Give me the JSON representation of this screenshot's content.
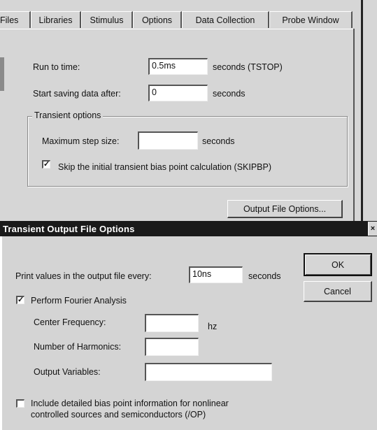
{
  "sim_settings": {
    "tabs": [
      "Files",
      "Libraries",
      "Stimulus",
      "Options",
      "Data Collection",
      "Probe Window"
    ],
    "run_to_time_label": "Run to time:",
    "run_to_time_value": "0.5ms",
    "run_to_time_units": "seconds (TSTOP)",
    "start_saving_label": "Start saving data after:",
    "start_saving_value": "0",
    "start_saving_units": "seconds",
    "transient_group_label": "Transient options",
    "max_step_label": "Maximum step size:",
    "max_step_value": "",
    "max_step_units": "seconds",
    "skip_bias_checked": true,
    "skip_bias_label": "Skip the initial transient bias point calculation  (SKIPBP)",
    "output_file_options_label": "Output File Options..."
  },
  "output_dialog": {
    "title": "Transient Output File Options",
    "print_values_label": "Print values in the output file every:",
    "print_values_value": "10ns",
    "print_values_units": "seconds",
    "ok_label": "OK",
    "cancel_label": "Cancel",
    "fourier_checked": true,
    "fourier_label": "Perform Fourier Analysis",
    "center_freq_label": "Center Frequency:",
    "center_freq_value": "",
    "center_freq_units": "hz",
    "harmonics_label": "Number of Harmonics:",
    "harmonics_value": "",
    "output_vars_label": "Output Variables:",
    "output_vars_value": "",
    "detailed_bias_checked": false,
    "detailed_bias_line1": "Include detailed bias point information for nonlinear",
    "detailed_bias_line2": "controlled sources and semiconductors (/OP)"
  }
}
